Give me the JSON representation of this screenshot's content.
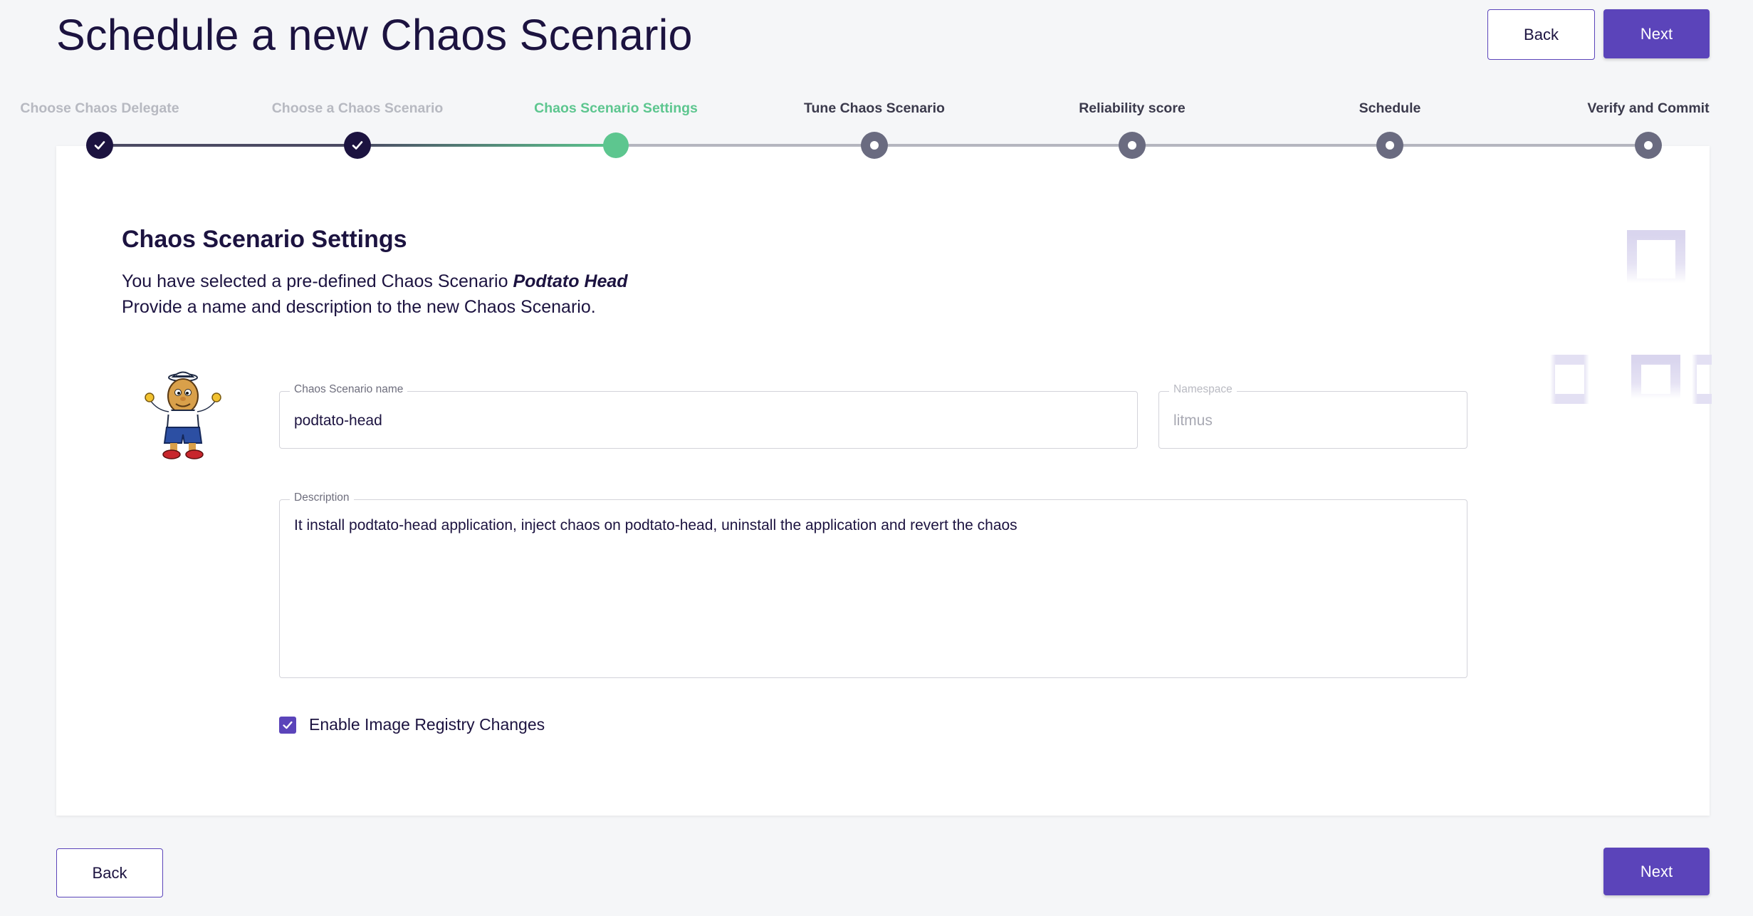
{
  "header": {
    "title": "Schedule a new Chaos Scenario",
    "back_label": "Back",
    "next_label": "Next"
  },
  "stepper": {
    "steps": [
      {
        "label": "Choose Chaos Delegate",
        "state": "done"
      },
      {
        "label": "Choose a Chaos Scenario",
        "state": "done"
      },
      {
        "label": "Chaos Scenario Settings",
        "state": "active"
      },
      {
        "label": "Tune Chaos Scenario",
        "state": "todo"
      },
      {
        "label": "Reliability score",
        "state": "todo"
      },
      {
        "label": "Schedule",
        "state": "todo"
      },
      {
        "label": "Verify and Commit",
        "state": "todo"
      }
    ],
    "colors": {
      "done": "#1c1340",
      "active": "#5dc68f",
      "todo": "#6a6b80"
    }
  },
  "settings": {
    "title": "Chaos Scenario Settings",
    "intro_prefix": "You have selected a pre-defined Chaos Scenario ",
    "scenario_name": "Podtato Head",
    "intro_line2": "Provide a name and description to the new Chaos Scenario.",
    "name_field": {
      "label": "Chaos Scenario name",
      "value": "podtato-head"
    },
    "namespace_field": {
      "label": "Namespace",
      "value": "litmus"
    },
    "description_field": {
      "label": "Description",
      "value": "It install podtato-head application, inject chaos on podtato-head, uninstall the application  and revert the chaos"
    },
    "image_registry_checkbox": {
      "label": "Enable Image Registry Changes",
      "checked": true
    }
  },
  "footer": {
    "back_label": "Back",
    "next_label": "Next"
  },
  "icons": {
    "check": "check-icon",
    "mascot": "podtato-head-mascot",
    "workflow": "workflow-illustration"
  },
  "colors": {
    "primary": "#5b44ba",
    "heading": "#1c1340",
    "success": "#5dc68f",
    "background": "#f5f6f8"
  }
}
